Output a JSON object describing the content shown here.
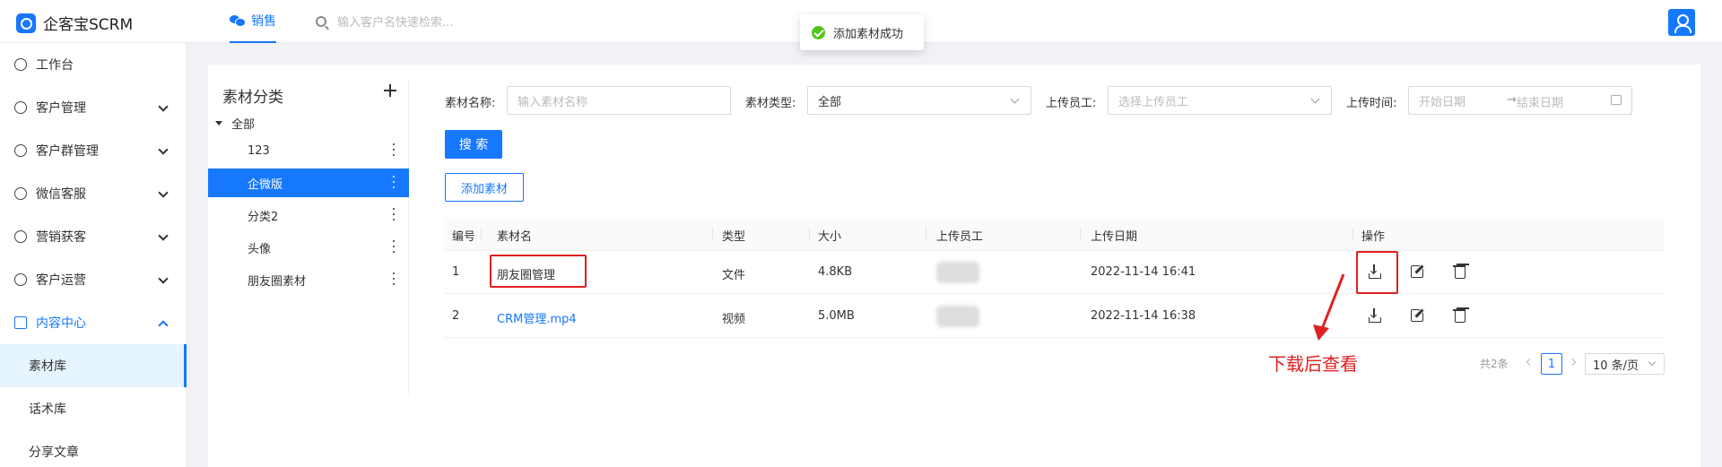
{
  "app": {
    "title": "企客宝SCRM"
  },
  "header": {
    "nav_active": "销售",
    "search_placeholder": "输入客户名快速检索..."
  },
  "toast": {
    "text": "添加素材成功"
  },
  "sidebar": {
    "items": [
      {
        "label": "工作台"
      },
      {
        "label": "客户管理"
      },
      {
        "label": "客户群管理"
      },
      {
        "label": "微信客服"
      },
      {
        "label": "营销获客"
      },
      {
        "label": "客户运营"
      },
      {
        "label": "内容中心"
      }
    ],
    "sub_items": [
      {
        "label": "素材库"
      },
      {
        "label": "话术库"
      },
      {
        "label": "分享文章"
      }
    ]
  },
  "category": {
    "title": "素材分类",
    "root": "全部",
    "nodes": [
      {
        "label": "123"
      },
      {
        "label": "企微版"
      },
      {
        "label": "分类2"
      },
      {
        "label": "头像"
      },
      {
        "label": "朋友圈素材"
      }
    ]
  },
  "filters": {
    "name_label": "素材名称:",
    "name_placeholder": "输入素材名称",
    "type_label": "素材类型:",
    "type_value": "全部",
    "uploader_label": "上传员工:",
    "uploader_placeholder": "选择上传员工",
    "time_label": "上传时间:",
    "start_placeholder": "开始日期",
    "date_sep": "→",
    "end_placeholder": "结束日期",
    "search_btn": "搜 索",
    "add_btn": "添加素材"
  },
  "table": {
    "columns": [
      "编号",
      "素材名",
      "类型",
      "大小",
      "上传员工",
      "上传日期",
      "操作"
    ],
    "rows": [
      {
        "id": "1",
        "name": "朋友圈管理",
        "type": "文件",
        "size": "4.8KB",
        "date": "2022-11-14 16:41"
      },
      {
        "id": "2",
        "name": "CRM管理.mp4",
        "type": "视频",
        "size": "5.0MB",
        "date": "2022-11-14 16:38"
      }
    ]
  },
  "annotation": {
    "text": "下载后查看",
    "color": "#e02020"
  },
  "pagination": {
    "total": "共2条",
    "current": "1",
    "page_size": "10 条/页"
  },
  "colors": {
    "primary": "#1677ff",
    "success": "#52c41a",
    "highlight": "#e02020"
  }
}
